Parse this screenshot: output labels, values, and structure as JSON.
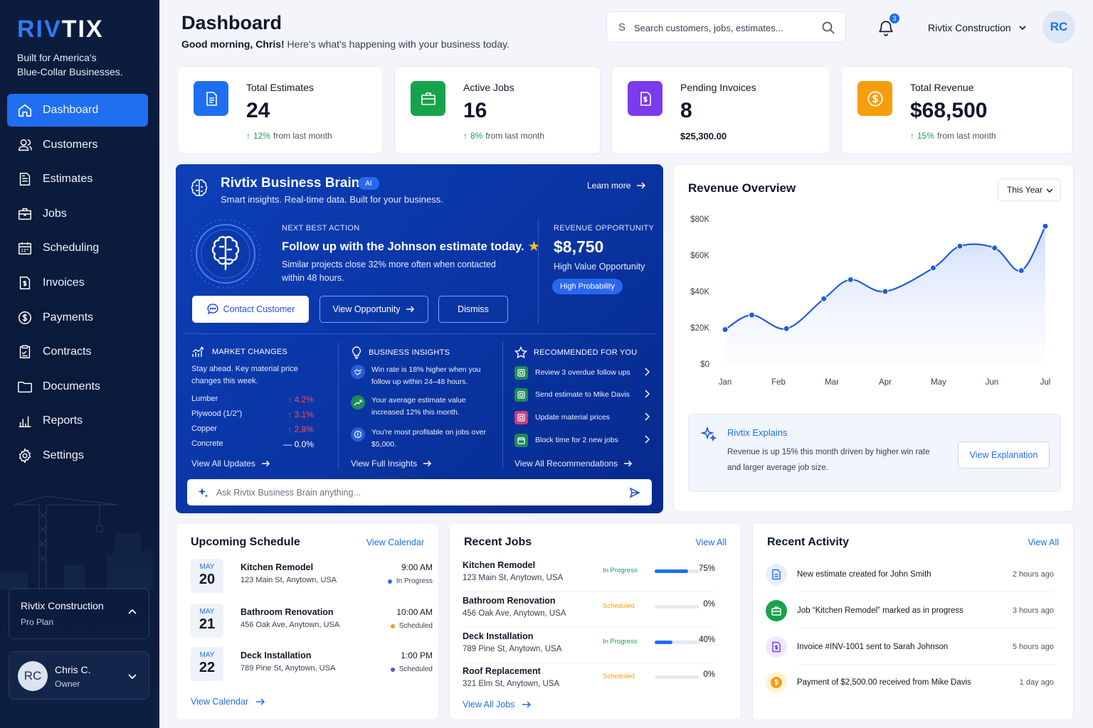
{
  "sidebar": {
    "logo": "RIVTIX",
    "tagline_line1": "Built for America's",
    "tagline_line2": "Blue-Collar Businesses.",
    "items": [
      {
        "label": "Dashboard",
        "icon": "home-icon"
      },
      {
        "label": "Customers",
        "icon": "users-icon"
      },
      {
        "label": "Estimates",
        "icon": "file-icon"
      },
      {
        "label": "Jobs",
        "icon": "briefcase-icon"
      },
      {
        "label": "Scheduling",
        "icon": "calendar-icon"
      },
      {
        "label": "Invoices",
        "icon": "invoice-icon"
      },
      {
        "label": "Payments",
        "icon": "dollar-icon"
      },
      {
        "label": "Contracts",
        "icon": "contract-icon"
      },
      {
        "label": "Documents",
        "icon": "folder-icon"
      },
      {
        "label": "Reports",
        "icon": "chart-icon"
      },
      {
        "label": "Settings",
        "icon": "gear-icon"
      }
    ],
    "org": {
      "name": "Rivtix Construction",
      "plan": "Pro Plan"
    },
    "user": {
      "initials": "RC",
      "name": "Chris C.",
      "role": "Owner"
    }
  },
  "header": {
    "title": "Dashboard",
    "greeting_bold": "Good morning, Chris!",
    "greeting_rest": " Here's what's happening with your business today.",
    "search_prefix": "S",
    "search_placeholder": "Search customers, jobs, estimates...",
    "notification_count": "3",
    "company": "Rivtix Construction",
    "avatar_initials": "RC"
  },
  "stats": [
    {
      "label": "Total Estimates",
      "value": "24",
      "change": "12%",
      "change_text": "from last month",
      "color": "#1f6ef0",
      "icon": "document-icon"
    },
    {
      "label": "Active Jobs",
      "value": "16",
      "change": "8%",
      "change_text": "from last month",
      "color": "#16a34a",
      "icon": "briefcase-icon"
    },
    {
      "label": "Pending Invoices",
      "value": "8",
      "sub": "$25,300.00",
      "color": "#7c3aed",
      "icon": "invoice-dollar-icon"
    },
    {
      "label": "Total Revenue",
      "value": "$68,500",
      "change": "15%",
      "change_text": "from last month",
      "color": "#f59e0b",
      "icon": "dollar-coin-icon"
    }
  ],
  "brain": {
    "title": "Rivtix Business Brain",
    "ai_badge": "AI",
    "subtitle": "Smart insights. Real-time data. Built for your business.",
    "learn_more": "Learn more",
    "nba_label": "NEXT BEST ACTION",
    "nba_title": "Follow up with the Johnson estimate today.",
    "nba_desc": "Similar projects close 32% more often when contacted within 48 hours.",
    "opp_label": "REVENUE OPPORTUNITY",
    "opp_value": "$8,750",
    "opp_sub": "High Value Opportunity",
    "opp_badge": "High Probability",
    "btn_contact": "Contact Customer",
    "btn_view": "View Opportunity",
    "btn_dismiss": "Dismiss",
    "market": {
      "title": "MARKET CHANGES",
      "desc": "Stay ahead. Key material price changes this week.",
      "rows": [
        {
          "name": "Lumber",
          "value": "4.2%",
          "dir": "up"
        },
        {
          "name": "Plywood (1/2\")",
          "value": "3.1%",
          "dir": "up"
        },
        {
          "name": "Copper",
          "value": "2.8%",
          "dir": "up"
        },
        {
          "name": "Concrete",
          "value": "0.0%",
          "dir": "flat"
        }
      ],
      "link": "View All Updates"
    },
    "insights": {
      "title": "BUSINESS INSIGHTS",
      "items": [
        "Win rate is 18% higher when you follow up within 24–48 hours.",
        "Your average estimate value increased 12% this month.",
        "You're most profitable on jobs over $5,000."
      ],
      "link": "View Full Insights"
    },
    "recommended": {
      "title": "RECOMMENDED FOR YOU",
      "items": [
        {
          "label": "Review 3 overdue follow ups",
          "color": "#22c55e"
        },
        {
          "label": "Send estimate to Mike Davis",
          "color": "#22c55e"
        },
        {
          "label": "Update material prices",
          "color": "#ec4899"
        },
        {
          "label": "Block time for 2 new jobs",
          "color": "#22c55e"
        }
      ],
      "link": "View All Recommendations"
    },
    "ask_placeholder": "Ask Rivtix Business Brain anything..."
  },
  "revenue": {
    "title": "Revenue Overview",
    "period": "This Year",
    "explain_title": "Rivtix Explains",
    "explain_text": "Revenue is up 15% this month driven by higher win rate and larger average job size.",
    "explain_button": "View Explanation"
  },
  "chart_data": {
    "type": "area",
    "title": "Revenue Overview",
    "categories": [
      "Jan",
      "Feb",
      "Mar",
      "Apr",
      "May",
      "Jun",
      "Jul"
    ],
    "x": [
      0,
      0.5,
      1,
      1.5,
      2,
      2.5,
      3,
      3.5,
      4,
      4.5,
      5,
      5.5,
      6
    ],
    "values": [
      19000,
      27000,
      19500,
      36000,
      46500,
      40000,
      53000,
      65000,
      64000,
      51500,
      76000
    ],
    "x_positions": [
      0,
      0.5,
      1.15,
      1.85,
      2.35,
      3,
      3.9,
      4.4,
      5.05,
      5.55,
      6
    ],
    "yticks": [
      "$0",
      "$20K",
      "$40K",
      "$60K",
      "$80K"
    ],
    "ylim": [
      0,
      80000
    ],
    "grid": false,
    "color": "#1f5be0"
  },
  "schedule": {
    "title": "Upcoming Schedule",
    "view_link": "View Calendar",
    "items": [
      {
        "month": "MAY",
        "day": "20",
        "name": "Kitchen Remodel",
        "address": "123 Main St, Anytown, USA",
        "time": "9:00 AM",
        "status": "In Progress",
        "status_color": "#1f6ef0"
      },
      {
        "month": "MAY",
        "day": "21",
        "name": "Bathroom Renovation",
        "address": "456 Oak Ave, Anytown, USA",
        "time": "10:00 AM",
        "status": "Scheduled",
        "status_color": "#f59e0b"
      },
      {
        "month": "MAY",
        "day": "22",
        "name": "Deck Installation",
        "address": "789 Pine St, Anytown, USA",
        "time": "1:00 PM",
        "status": "Scheduled",
        "status_color": "#7c3aed"
      }
    ],
    "footer_link": "View Calendar"
  },
  "jobs": {
    "title": "Recent Jobs",
    "view_link": "View All",
    "items": [
      {
        "name": "Kitchen Remodel",
        "address": "123 Main St, Anytown, USA",
        "status": "In Progress",
        "status_color": "#16a34a",
        "progress": 0.75,
        "percent": "75%"
      },
      {
        "name": "Bathroom Renovation",
        "address": "456 Oak Ave, Anytown, USA",
        "status": "Scheduled",
        "status_color": "#f59e0b",
        "progress": 0,
        "percent": "0%"
      },
      {
        "name": "Deck Installation",
        "address": "789 Pine St, Anytown, USA",
        "status": "In Progress",
        "status_color": "#16a34a",
        "progress": 0.4,
        "percent": "40%"
      },
      {
        "name": "Roof Replacement",
        "address": "321 Elm St, Anytown, USA",
        "status": "Scheduled",
        "status_color": "#f59e0b",
        "progress": 0,
        "percent": "0%"
      }
    ],
    "footer_link": "View All Jobs"
  },
  "activity": {
    "title": "Recent Activity",
    "view_link": "View All",
    "items": [
      {
        "text": "New estimate created for John Smith",
        "time": "2 hours ago",
        "color": "#1f6ef0",
        "bg": "#e6efff",
        "icon": "document-icon"
      },
      {
        "text": "Job “Kitchen Remodel” marked as in progress",
        "time": "3 hours ago",
        "color": "#16a34a",
        "bg": "#16a34a",
        "icon": "briefcase-icon"
      },
      {
        "text": "Invoice #INV-1001 sent to Sarah Johnson",
        "time": "5 hours ago",
        "color": "#7c3aed",
        "bg": "#efe8ff",
        "icon": "invoice-icon"
      },
      {
        "text": "Payment of $2,500.00 received from Mike Davis",
        "time": "1 day ago",
        "color": "#f59e0b",
        "bg": "#fff2d9",
        "icon": "dollar-coin-icon"
      }
    ]
  }
}
